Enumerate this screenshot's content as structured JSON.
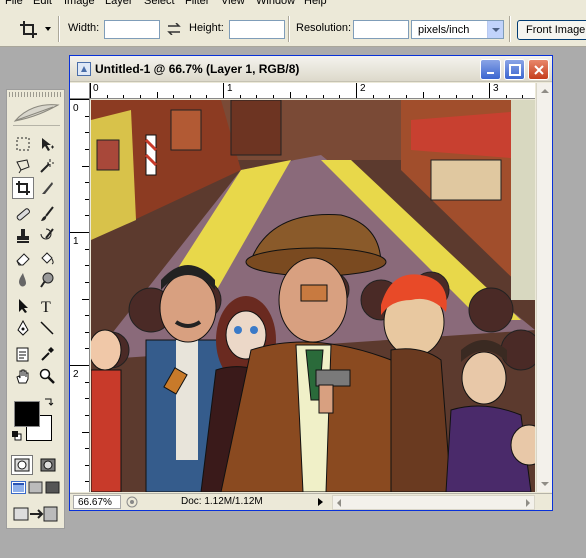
{
  "menu": [
    "File",
    "Edit",
    "Image",
    "Layer",
    "Select",
    "Filter",
    "View",
    "Window",
    "Help"
  ],
  "options_bar": {
    "width_label": "Width:",
    "width_value": "",
    "height_label": "Height:",
    "height_value": "",
    "resolution_label": "Resolution:",
    "resolution_value": "",
    "units": "pixels/inch",
    "front_image_button": "Front Image",
    "active_tool_icon": "crop-icon"
  },
  "toolbox": {
    "tools": [
      [
        "marquee-icon",
        "move-icon"
      ],
      [
        "lasso-icon",
        "magic-wand-icon"
      ],
      [
        "crop-icon",
        "slice-icon"
      ],
      [
        "healing-brush-icon",
        "brush-icon"
      ],
      [
        "clone-stamp-icon",
        "history-brush-icon"
      ],
      [
        "eraser-icon",
        "paint-bucket-icon"
      ],
      [
        "blur-icon",
        "dodge-icon"
      ],
      [
        "path-selection-icon",
        "type-icon"
      ],
      [
        "pen-icon",
        "line-shape-icon"
      ],
      [
        "notes-icon",
        "eyedropper-icon"
      ],
      [
        "hand-icon",
        "zoom-icon"
      ]
    ],
    "foreground_color": "#000000",
    "background_color": "#ffffff"
  },
  "document": {
    "title": "Untitled-1 @ 66.7% (Layer 1, RGB/8)",
    "zoom": "66.67%",
    "doc_size": "Doc: 1.12M/1.12M",
    "ruler_top_numbers": [
      "0",
      "1",
      "2",
      "3"
    ],
    "ruler_left_numbers": [
      "0",
      "1",
      "2"
    ]
  },
  "colors": {
    "titlebar_border": "#0831d9",
    "close_button": "#c63d1c",
    "window_button": "#3c66d0"
  }
}
